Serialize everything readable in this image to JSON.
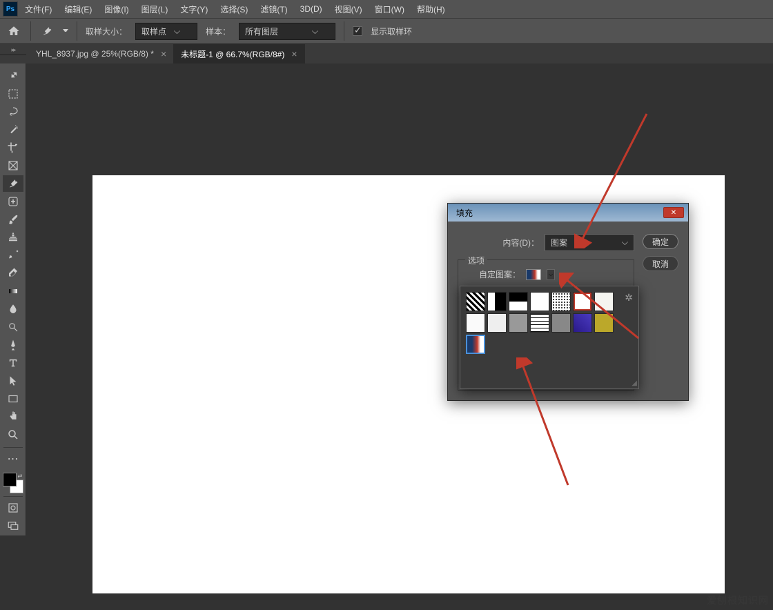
{
  "menubar": {
    "items": [
      "文件(F)",
      "编辑(E)",
      "图像(I)",
      "图层(L)",
      "文字(Y)",
      "选择(S)",
      "滤镜(T)",
      "3D(D)",
      "视图(V)",
      "窗口(W)",
      "帮助(H)"
    ]
  },
  "optionsbar": {
    "sample_size_label": "取样大小：",
    "sample_size_value": "取样点",
    "sample_label": "样本：",
    "sample_value": "所有图层",
    "show_ring_label": "显示取样环"
  },
  "tabs": [
    {
      "label": "YHL_8937.jpg @ 25%(RGB/8) *",
      "active": false
    },
    {
      "label": "未标题-1 @ 66.7%(RGB/8#)",
      "active": true
    }
  ],
  "dialog": {
    "title": "填充",
    "content_label": "内容(D)：",
    "content_value": "图案",
    "options_label": "选项",
    "custom_pattern_label": "自定图案：",
    "ok": "确定",
    "cancel": "取消"
  },
  "watermark": "爱刨根知识网"
}
